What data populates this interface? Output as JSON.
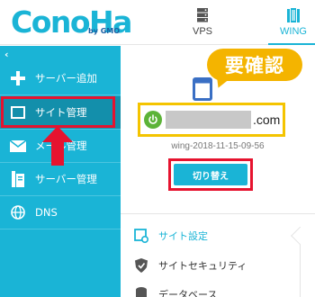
{
  "header": {
    "logo_text": "ConoHa",
    "logo_sub": "by GMO",
    "tabs": [
      {
        "label": "VPS",
        "icon": "server-icon"
      },
      {
        "label": "WING",
        "icon": "building-icon",
        "active": true
      }
    ]
  },
  "sidebar": {
    "collapse_glyph": "‹",
    "items": [
      {
        "label": "サーバー追加",
        "icon": "plus-icon"
      },
      {
        "label": "サイト管理",
        "icon": "window-icon",
        "active": true
      },
      {
        "label": "メール管理",
        "icon": "mail-icon"
      },
      {
        "label": "サーバー管理",
        "icon": "server-stack-icon"
      },
      {
        "label": "DNS",
        "icon": "globe-icon"
      }
    ]
  },
  "annotation": {
    "bubble_text": "要確認"
  },
  "site": {
    "domain_suffix": ".com",
    "server_name": "wing-2018-11-15-09-56",
    "switch_label": "切り替え"
  },
  "site_menu": [
    {
      "label": "サイト設定",
      "icon": "site-settings-icon",
      "active": true
    },
    {
      "label": "サイトセキュリティ",
      "icon": "shield-icon"
    },
    {
      "label": "データベース",
      "icon": "database-icon"
    }
  ],
  "colors": {
    "brand": "#1ab4d6",
    "highlight_red": "#e6132f",
    "highlight_yellow": "#f4c400",
    "power_green": "#5cb338"
  }
}
